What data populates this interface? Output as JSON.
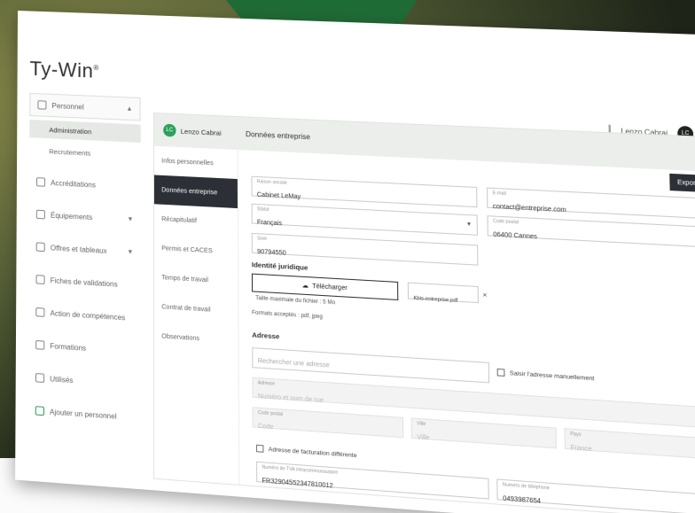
{
  "app": {
    "logo": "Ty-Win",
    "logo_mark": "®"
  },
  "header": {
    "user_name": "Lenzo Cabrai",
    "avatar_initials": "LC"
  },
  "sidebar": {
    "parent_label": "Personnel",
    "sub_items": [
      "Administration",
      "Recrutements"
    ],
    "items": [
      "Accréditations",
      "Équipements",
      "Offres et tableaux",
      "Fiches de validations",
      "Action de compétences",
      "Formations",
      "Utilisés",
      "Ajouter un personnel"
    ]
  },
  "panel": {
    "user_chip": "Lenzo Cabrai",
    "user_chip_initials": "LC",
    "title": "Données entreprise",
    "save_label": "Exporter",
    "tabs": [
      "Infos personnelles",
      "Données entreprise",
      "Récapitulatif",
      "Permis et CACES",
      "Temps de travail",
      "Contrat de travail",
      "Observations"
    ]
  },
  "form": {
    "f1": {
      "label": "Raison sociale",
      "value": "Cabinet LeMay"
    },
    "f2": {
      "label": "E-mail",
      "value": "contact@entreprise.com"
    },
    "f3": {
      "label": "Statut",
      "value": "Français"
    },
    "f4": {
      "label": "Code postal",
      "value": "06400 Cannes"
    },
    "f5": {
      "label": "Siret",
      "value": "90794550"
    },
    "identity_section": "Identité juridique",
    "download_label": "Télécharger",
    "file_name": "Kbis-entreprise.pdf",
    "upload_note_1": "Taille maximale du fichier : 5 Mo",
    "upload_note_2": "Formats acceptés : pdf, jpeg",
    "address_section": "Adresse",
    "address_placeholder": "Rechercher une adresse",
    "manual_entry": "Saisir l'adresse manuellement",
    "street_label": "Adresse",
    "street_placeholder": "Numéro et nom de rue",
    "zip_label": "Code postal",
    "zip_placeholder": "Code",
    "city_label": "Ville",
    "city_placeholder": "Ville",
    "country_label": "Pays",
    "country_placeholder": "France",
    "billing_check": "Adresse de facturation différente",
    "bottom1": {
      "label": "Numéro de TVA intracommunautaire",
      "value": "FR32904552347810012"
    },
    "bottom2": {
      "label": "Numéro de téléphone",
      "value": "0493987654"
    }
  }
}
